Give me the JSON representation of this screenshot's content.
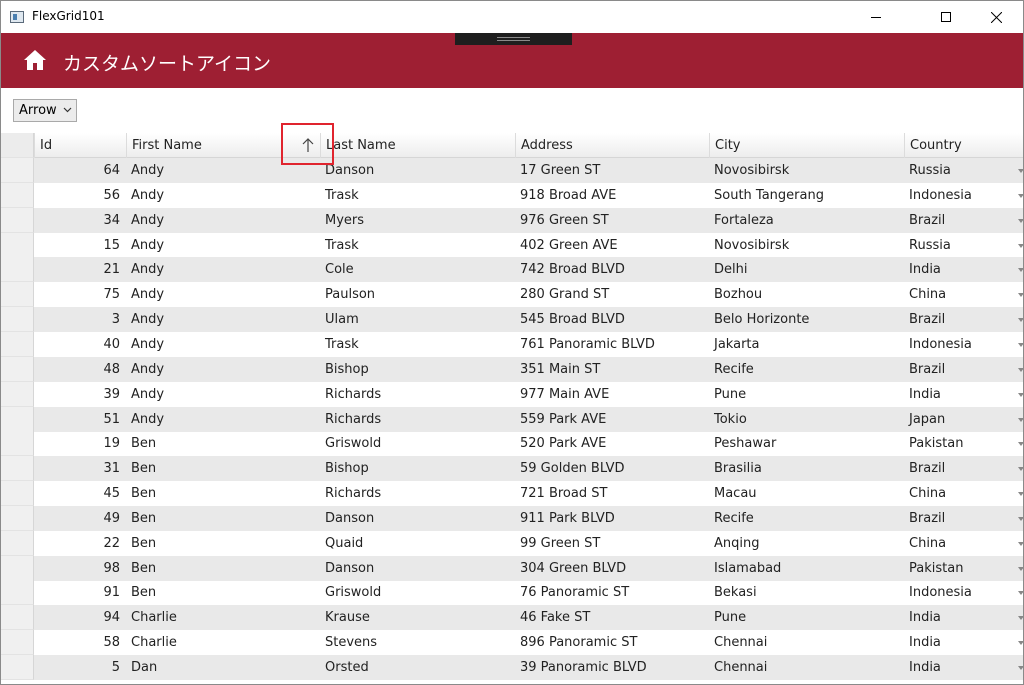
{
  "window": {
    "title": "FlexGrid101"
  },
  "header": {
    "title": "カスタムソートアイコン"
  },
  "combo": {
    "value": "Arrow"
  },
  "grid": {
    "columns": [
      "Id",
      "First Name",
      "Last Name",
      "Address",
      "City",
      "Country"
    ],
    "sorted_column": "Last Name",
    "sort_direction": "ascending",
    "rows": [
      {
        "id": "64",
        "first": "Andy",
        "last": "Danson",
        "address": "17 Green ST",
        "city": "Novosibirsk",
        "country": "Russia"
      },
      {
        "id": "56",
        "first": "Andy",
        "last": "Trask",
        "address": "918 Broad AVE",
        "city": "South Tangerang",
        "country": "Indonesia"
      },
      {
        "id": "34",
        "first": "Andy",
        "last": "Myers",
        "address": "976 Green ST",
        "city": "Fortaleza",
        "country": "Brazil"
      },
      {
        "id": "15",
        "first": "Andy",
        "last": "Trask",
        "address": "402 Green AVE",
        "city": "Novosibirsk",
        "country": "Russia"
      },
      {
        "id": "21",
        "first": "Andy",
        "last": "Cole",
        "address": "742 Broad BLVD",
        "city": "Delhi",
        "country": "India"
      },
      {
        "id": "75",
        "first": "Andy",
        "last": "Paulson",
        "address": "280 Grand ST",
        "city": "Bozhou",
        "country": "China"
      },
      {
        "id": "3",
        "first": "Andy",
        "last": "Ulam",
        "address": "545 Broad BLVD",
        "city": "Belo Horizonte",
        "country": "Brazil"
      },
      {
        "id": "40",
        "first": "Andy",
        "last": "Trask",
        "address": "761 Panoramic BLVD",
        "city": "Jakarta",
        "country": "Indonesia"
      },
      {
        "id": "48",
        "first": "Andy",
        "last": "Bishop",
        "address": "351 Main ST",
        "city": "Recife",
        "country": "Brazil"
      },
      {
        "id": "39",
        "first": "Andy",
        "last": "Richards",
        "address": "977 Main AVE",
        "city": "Pune",
        "country": "India"
      },
      {
        "id": "51",
        "first": "Andy",
        "last": "Richards",
        "address": "559 Park AVE",
        "city": "Tokio",
        "country": "Japan"
      },
      {
        "id": "19",
        "first": "Ben",
        "last": "Griswold",
        "address": "520 Park AVE",
        "city": "Peshawar",
        "country": "Pakistan"
      },
      {
        "id": "31",
        "first": "Ben",
        "last": "Bishop",
        "address": "59 Golden BLVD",
        "city": "Brasilia",
        "country": "Brazil"
      },
      {
        "id": "45",
        "first": "Ben",
        "last": "Richards",
        "address": "721 Broad ST",
        "city": "Macau",
        "country": "China"
      },
      {
        "id": "49",
        "first": "Ben",
        "last": "Danson",
        "address": "911 Park BLVD",
        "city": "Recife",
        "country": "Brazil"
      },
      {
        "id": "22",
        "first": "Ben",
        "last": "Quaid",
        "address": "99 Green ST",
        "city": "Anqing",
        "country": "China"
      },
      {
        "id": "98",
        "first": "Ben",
        "last": "Danson",
        "address": "304 Green BLVD",
        "city": "Islamabad",
        "country": "Pakistan"
      },
      {
        "id": "91",
        "first": "Ben",
        "last": "Griswold",
        "address": "76 Panoramic ST",
        "city": "Bekasi",
        "country": "Indonesia"
      },
      {
        "id": "94",
        "first": "Charlie",
        "last": "Krause",
        "address": "46 Fake ST",
        "city": "Pune",
        "country": "India"
      },
      {
        "id": "58",
        "first": "Charlie",
        "last": "Stevens",
        "address": "896 Panoramic ST",
        "city": "Chennai",
        "country": "India"
      },
      {
        "id": "5",
        "first": "Dan",
        "last": "Orsted",
        "address": "39 Panoramic BLVD",
        "city": "Chennai",
        "country": "India"
      }
    ]
  },
  "colors": {
    "header_bg": "#9e1f33",
    "highlight": "#e0242e",
    "alt_row": "#e9e9e9"
  },
  "icons": {
    "home": "home-icon",
    "sort": "sort-ascending-arrow-icon"
  }
}
